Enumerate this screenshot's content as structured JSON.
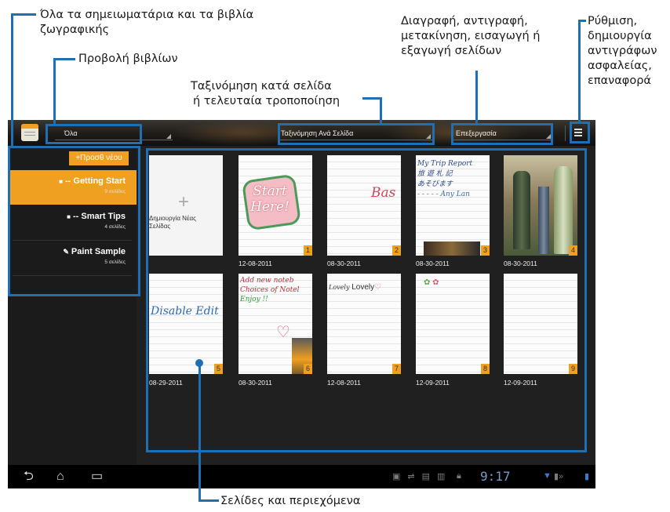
{
  "annotations": {
    "all_notebooks": [
      "Όλα τα σημειωματάρια και τα βιβλία",
      "ζωγραφικής"
    ],
    "book_view": "Προβολή βιβλίων",
    "sort": [
      "Ταξινόμηση κατά σελίδα",
      "ή τελευταία τροποποίηση"
    ],
    "edit_pages": [
      "Διαγραφή, αντιγραφή,",
      "μετακίνηση, εισαγωγή ή",
      "εξαγωγή σελίδων"
    ],
    "settings": [
      "Ρύθμιση,",
      "δημιουργία",
      "αντιγράφων",
      "ασφαλείας,",
      "επαναφορά"
    ],
    "pages_content": "Σελίδες και περιεχόμενα"
  },
  "topbar": {
    "filter_value": "Όλα",
    "sort_value": "Ταξινόμηση Ανά Σελίδα",
    "edit_value": "Επεξεργασία"
  },
  "sidebar": {
    "add_new_label": "Προσθ νέου",
    "items": [
      {
        "title": "-- Getting Start",
        "subtitle": "9 σελίδες"
      },
      {
        "title": "-- Smart Tips",
        "subtitle": "4 σελίδες"
      },
      {
        "title": "Paint Sample",
        "subtitle": "5 σελίδες"
      }
    ]
  },
  "pages": {
    "new_page_label": "Δημιουργία Νέας Σελίδας",
    "row1": [
      {
        "num": "1",
        "date": "12-08-2011",
        "text": "Start Here!"
      },
      {
        "num": "2",
        "date": "08-30-2011",
        "text": "Bas"
      },
      {
        "num": "3",
        "date": "08-30-2011",
        "text": "My Trip Report"
      },
      {
        "num": "4",
        "date": "08-30-2011",
        "text": ""
      }
    ],
    "row2": [
      {
        "num": "5",
        "date": "08-29-2011",
        "text": "Disable Edit"
      },
      {
        "num": "6",
        "date": "08-30-2011",
        "text": "Add new noteb"
      },
      {
        "num": "7",
        "date": "12-08-2011",
        "text": "Lovely"
      },
      {
        "num": "8",
        "date": "12-09-2011",
        "text": ""
      },
      {
        "num": "9",
        "date": "12-09-2011",
        "text": ""
      }
    ],
    "p3_lines": [
      "My Trip Report",
      "旅 遊 札 記",
      "あそびます",
      "- - - - - Any Lan"
    ],
    "p6_lines": [
      "Add new noteb",
      "Choices of Notel",
      "Enjoy !!"
    ],
    "p7_prefix": "Lovely"
  },
  "statusbar": {
    "time": "9:17"
  },
  "colors": {
    "callout": "#1f6fb5",
    "accent": "#f0a020",
    "screen_bg": "#161616"
  }
}
